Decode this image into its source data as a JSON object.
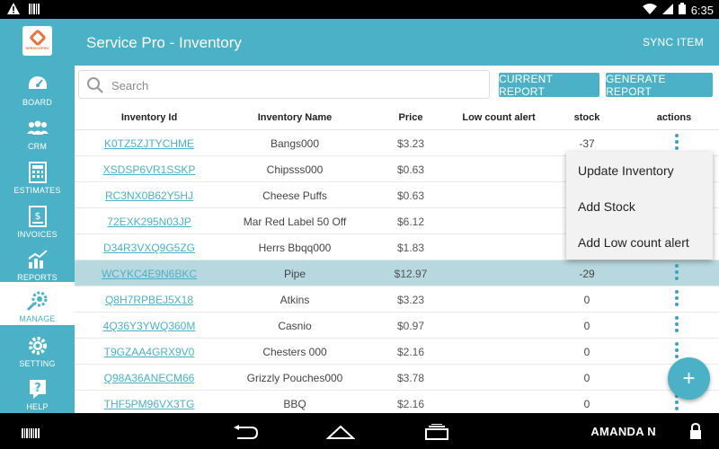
{
  "statusbar": {
    "time": "6:35",
    "icons": [
      "warning-icon",
      "barcode-icon",
      "wifi-icon",
      "signal-icon",
      "battery-icon"
    ]
  },
  "brand": {
    "name": "SERVICEPRO"
  },
  "sidebar": {
    "items": [
      {
        "label": "BOARD",
        "icon": "dashboard-icon",
        "active": false
      },
      {
        "label": "CRM",
        "icon": "people-icon",
        "active": false
      },
      {
        "label": "ESTIMATES",
        "icon": "estimates-icon",
        "active": false
      },
      {
        "label": "INVOICES",
        "icon": "invoice-icon",
        "active": false
      },
      {
        "label": "REPORTS",
        "icon": "chart-icon",
        "active": false
      },
      {
        "label": "MANAGE",
        "icon": "manage-gear-icon",
        "active": true
      },
      {
        "label": "SETTING",
        "icon": "gear-icon",
        "active": false
      },
      {
        "label": "HELP",
        "icon": "help-icon",
        "active": false
      }
    ]
  },
  "header": {
    "title": "Service Pro - Inventory",
    "sync_label": "SYNC ITEM"
  },
  "search": {
    "placeholder": "Search",
    "value": ""
  },
  "buttons": {
    "current_report": "CURRENT REPORT",
    "generate_report": "GENERATE REPORT"
  },
  "table": {
    "headers": [
      "Inventory Id",
      "Inventory Name",
      "Price",
      "Low count alert",
      "stock",
      "actions"
    ],
    "rows": [
      {
        "id": "K0TZ5ZJTYCHME",
        "name": "Bangs000",
        "price": "$3.23",
        "alert": "",
        "stock": "-37"
      },
      {
        "id": "XSDSP6VR1SSKP",
        "name": "Chipsss000",
        "price": "$0.63",
        "alert": "",
        "stock": ""
      },
      {
        "id": "RC3NX0B62Y5HJ",
        "name": "Cheese Puffs",
        "price": "$0.63",
        "alert": "",
        "stock": ""
      },
      {
        "id": "72EXK295N03JP",
        "name": "Mar Red Label 50 Off",
        "price": "$6.12",
        "alert": "",
        "stock": ""
      },
      {
        "id": "D34R3VXQ9G5ZG",
        "name": "Herrs Bbqq000",
        "price": "$1.83",
        "alert": "",
        "stock": ""
      },
      {
        "id": "WCYKC4E9N6BKC",
        "name": "Pipe",
        "price": "$12.97",
        "alert": "",
        "stock": "-29"
      },
      {
        "id": "Q8H7RPBEJ5X18",
        "name": "Atkins",
        "price": "$3.23",
        "alert": "",
        "stock": "0"
      },
      {
        "id": "4Q36Y3YWQ360M",
        "name": "Casnio",
        "price": "$0.97",
        "alert": "",
        "stock": "0"
      },
      {
        "id": "T9GZAA4GRX9V0",
        "name": "Chesters 000",
        "price": "$2.16",
        "alert": "",
        "stock": "0"
      },
      {
        "id": "Q98A36ANECM66",
        "name": "Grizzly Pouches000",
        "price": "$3.78",
        "alert": "",
        "stock": "0"
      },
      {
        "id": "THF5PM96VX3TG",
        "name": "BBQ",
        "price": "$2.16",
        "alert": "",
        "stock": "0"
      }
    ],
    "selected_index": 5
  },
  "popup_menu": {
    "items": [
      "Update Inventory",
      "Add Stock",
      "Add Low count alert"
    ]
  },
  "fab": {
    "icon": "plus-icon",
    "label": "+"
  },
  "navbar": {
    "user": "AMANDA N",
    "icons": [
      "barcode-icon",
      "back-icon",
      "home-icon",
      "recents-icon",
      "lock-icon"
    ]
  },
  "colors": {
    "accent": "#4bb1c6",
    "selected_row": "#b7d8de",
    "popup_bg": "#f2f2f2"
  }
}
